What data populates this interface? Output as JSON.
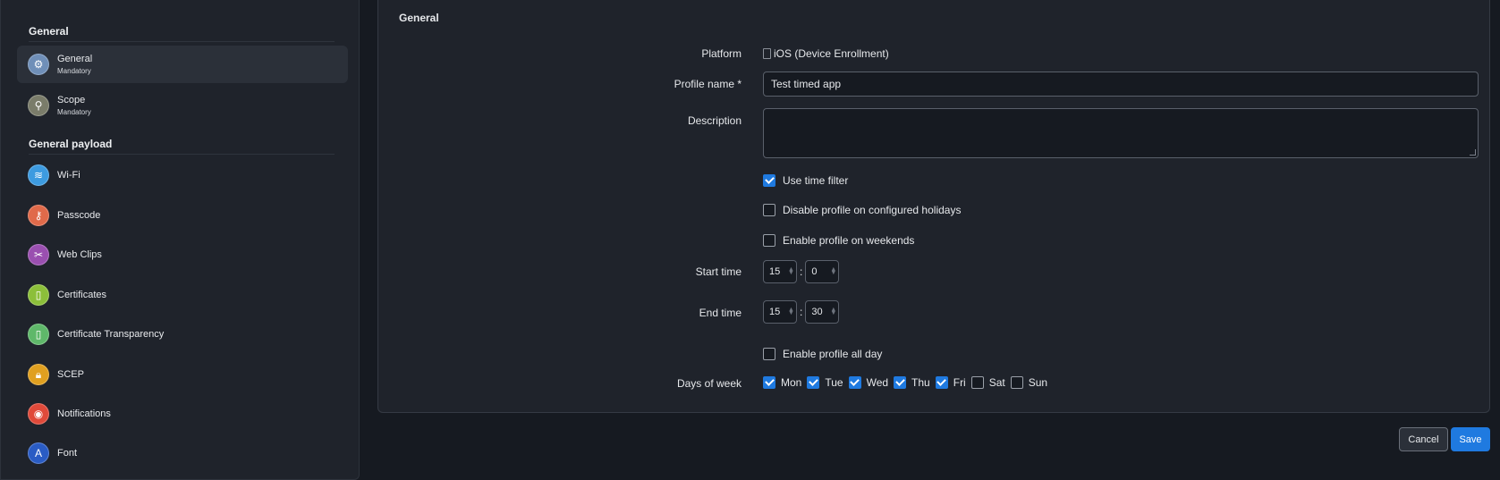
{
  "sidebar": {
    "section_general": "General",
    "section_payload": "General payload",
    "items": [
      {
        "label": "General",
        "sub": "Mandatory",
        "icon": "gear-icon",
        "color": "#6f8fb8"
      },
      {
        "label": "Scope",
        "sub": "Mandatory",
        "icon": "key-search-icon",
        "color": "#7a7c6a"
      },
      {
        "label": "Wi-Fi",
        "sub": "",
        "icon": "wifi-icon",
        "color": "#3d9be0"
      },
      {
        "label": "Passcode",
        "sub": "",
        "icon": "key-icon",
        "color": "#e06a4a"
      },
      {
        "label": "Web Clips",
        "sub": "",
        "icon": "scissors-icon",
        "color": "#9a4fb0"
      },
      {
        "label": "Certificates",
        "sub": "",
        "icon": "certificate-icon",
        "color": "#8cbf3a"
      },
      {
        "label": "Certificate Transparency",
        "sub": "",
        "icon": "certificate-transparency-icon",
        "color": "#5fb86a"
      },
      {
        "label": "SCEP",
        "sub": "",
        "icon": "lock-icon",
        "color": "#e0a020"
      },
      {
        "label": "Notifications",
        "sub": "",
        "icon": "notification-icon",
        "color": "#e04a3a"
      },
      {
        "label": "Font",
        "sub": "",
        "icon": "font-icon",
        "color": "#2a5cc4"
      }
    ]
  },
  "panel": {
    "title": "General",
    "platform_label": "Platform",
    "platform_value": "iOS (Device Enrollment)",
    "profile_name_label": "Profile name *",
    "profile_name_value": "Test timed app",
    "description_label": "Description",
    "use_time_filter": "Use time filter",
    "disable_holidays": "Disable profile on configured holidays",
    "enable_weekends": "Enable profile on weekends",
    "start_time_label": "Start time",
    "start_hour": "15",
    "start_minute": "0",
    "end_time_label": "End time",
    "end_hour": "15",
    "end_minute": "30",
    "time_separator": ":",
    "all_day": "Enable profile all day",
    "days_label": "Days of week",
    "days": [
      {
        "label": "Mon",
        "checked": true
      },
      {
        "label": "Tue",
        "checked": true
      },
      {
        "label": "Wed",
        "checked": true
      },
      {
        "label": "Thu",
        "checked": true
      },
      {
        "label": "Fri",
        "checked": true
      },
      {
        "label": "Sat",
        "checked": false
      },
      {
        "label": "Sun",
        "checked": false
      }
    ]
  },
  "buttons": {
    "cancel": "Cancel",
    "save": "Save"
  },
  "colors": {
    "accent": "#1f7ae0",
    "background": "#161a21",
    "panel": "#1f232b"
  }
}
